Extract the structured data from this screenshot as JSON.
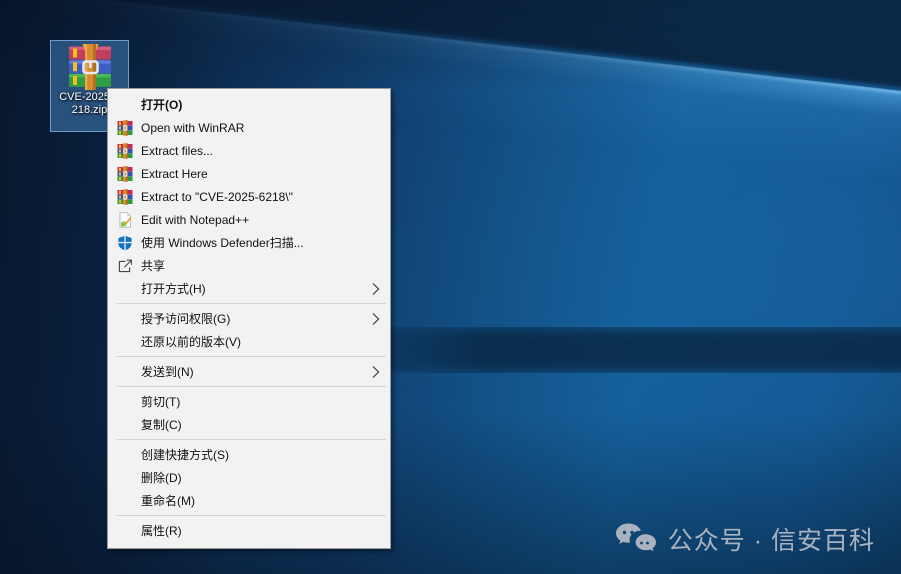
{
  "desktop": {
    "icon": {
      "name": "winrar-zip-archive",
      "label_line1": "CVE-2025-6",
      "label_line2": "218.zip"
    }
  },
  "context_menu": {
    "items": [
      {
        "id": "open",
        "label": "打开(O)",
        "bold": true
      },
      {
        "id": "open-with-winrar",
        "label": "Open with WinRAR",
        "icon": "winrar-icon"
      },
      {
        "id": "extract-files",
        "label": "Extract files...",
        "icon": "winrar-icon"
      },
      {
        "id": "extract-here",
        "label": "Extract Here",
        "icon": "winrar-icon"
      },
      {
        "id": "extract-to",
        "label": "Extract to \"CVE-2025-6218\\\"",
        "icon": "winrar-icon"
      },
      {
        "id": "edit-with-notepadpp",
        "label": "Edit with Notepad++",
        "icon": "notepadpp-icon"
      },
      {
        "id": "defender-scan",
        "label": "使用 Windows Defender扫描...",
        "icon": "defender-icon"
      },
      {
        "id": "share",
        "label": "共享",
        "icon": "share-icon"
      },
      {
        "id": "open-with",
        "label": "打开方式(H)",
        "submenu": true
      },
      {
        "type": "separator"
      },
      {
        "id": "give-access",
        "label": "授予访问权限(G)",
        "submenu": true
      },
      {
        "id": "restore-previous",
        "label": "还原以前的版本(V)"
      },
      {
        "type": "separator"
      },
      {
        "id": "send-to",
        "label": "发送到(N)",
        "submenu": true
      },
      {
        "type": "separator"
      },
      {
        "id": "cut",
        "label": "剪切(T)"
      },
      {
        "id": "copy",
        "label": "复制(C)"
      },
      {
        "type": "separator"
      },
      {
        "id": "create-shortcut",
        "label": "创建快捷方式(S)"
      },
      {
        "id": "delete",
        "label": "删除(D)"
      },
      {
        "id": "rename",
        "label": "重命名(M)"
      },
      {
        "type": "separator"
      },
      {
        "id": "properties",
        "label": "属性(R)"
      }
    ]
  },
  "watermark": {
    "text": "公众号 · 信安百科"
  },
  "colors": {
    "defender_shield": "#1173c6",
    "selection_highlight": "#569cde",
    "menu_background": "#f2f2f2",
    "wallpaper_base": "#11518a"
  }
}
